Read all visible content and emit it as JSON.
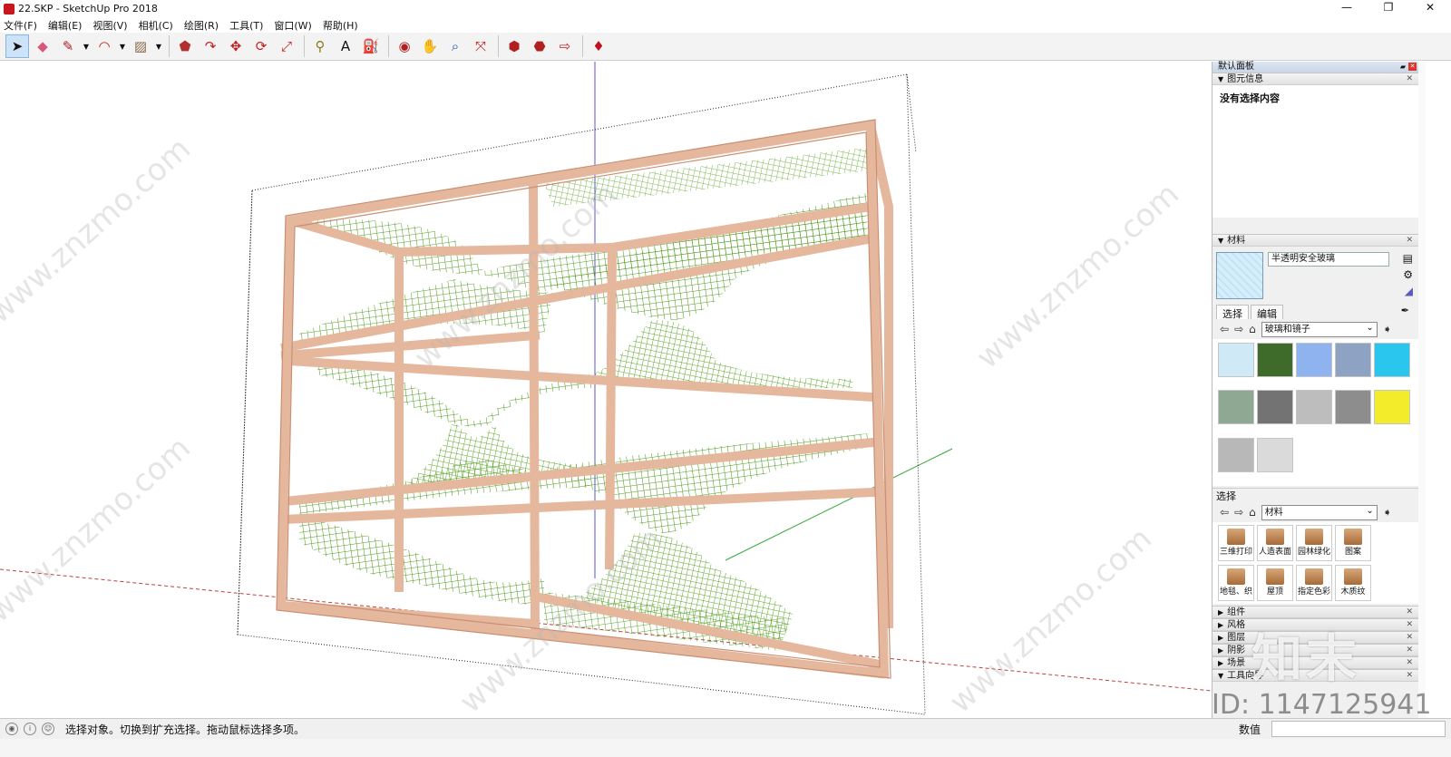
{
  "window": {
    "title": "22.SKP - SketchUp Pro 2018"
  },
  "menu": [
    "文件(F)",
    "编辑(E)",
    "视图(V)",
    "相机(C)",
    "绘图(R)",
    "工具(T)",
    "窗口(W)",
    "帮助(H)"
  ],
  "toolbar": [
    {
      "icon": "select-arrow-icon",
      "glyph": "➤"
    },
    {
      "icon": "eraser-icon",
      "glyph": "◆"
    },
    {
      "icon": "pencil-line-icon",
      "glyph": "✎"
    },
    {
      "icon": "arc-icon",
      "glyph": "◠"
    },
    {
      "icon": "rectangle-icon",
      "glyph": "▨"
    },
    {
      "icon": "push-pull-icon",
      "glyph": "⬟"
    },
    {
      "icon": "follow-me-icon",
      "glyph": "↷"
    },
    {
      "icon": "move-icon",
      "glyph": "✥"
    },
    {
      "icon": "rotate-icon",
      "glyph": "⟳"
    },
    {
      "icon": "scale-icon",
      "glyph": "⤢"
    },
    {
      "icon": "tape-measure-icon",
      "glyph": "⚲"
    },
    {
      "icon": "text-icon",
      "glyph": "A"
    },
    {
      "icon": "paint-bucket-icon",
      "glyph": "⛽"
    },
    {
      "icon": "orbit-icon",
      "glyph": "◉"
    },
    {
      "icon": "pan-hand-icon",
      "glyph": "✋"
    },
    {
      "icon": "zoom-icon",
      "glyph": "⌕"
    },
    {
      "icon": "zoom-extents-icon",
      "glyph": "⤧"
    },
    {
      "icon": "warehouse-icon",
      "glyph": "⬢"
    },
    {
      "icon": "extension-warehouse-icon",
      "glyph": "⬣"
    },
    {
      "icon": "send-to-layout-icon",
      "glyph": "⇨"
    },
    {
      "icon": "ruby-icon",
      "glyph": "♦"
    }
  ],
  "status": {
    "message": "选择对象。切换到扩充选择。拖动鼠标选择多项。",
    "vcb_label": "数值",
    "vcb_value": ""
  },
  "tray": {
    "title": "默认面板",
    "entity_info": {
      "header": "图元信息",
      "text": "没有选择内容"
    },
    "materials": {
      "header": "材料",
      "name": "半透明安全玻璃",
      "tabs": [
        "选择",
        "编辑"
      ],
      "library": "玻璃和镜子",
      "swatch_colors": [
        "#cfeaf6",
        "#3f6b2a",
        "#8fb3ef",
        "#8ea2c4",
        "#2bc6ee",
        "#8fa894",
        "#737373",
        "#bdbdbd",
        "#8d8d8d",
        "#f2ec2a",
        "#b8b8b8",
        "#dadada"
      ],
      "secondary_label": "选择",
      "secondary_library": "材料",
      "categories": [
        "三维打印",
        "人造表面",
        "园林绿化",
        "图案",
        "地毯、织",
        "屋顶",
        "指定色彩",
        "木质纹"
      ]
    },
    "collapsed": [
      "组件",
      "风格",
      "图层",
      "阴影",
      "场景",
      "工具向导"
    ]
  },
  "watermark": {
    "logo": "知末",
    "id": "ID: 1147125941",
    "url": "www.znzmo.com",
    "brand": "知末网"
  }
}
